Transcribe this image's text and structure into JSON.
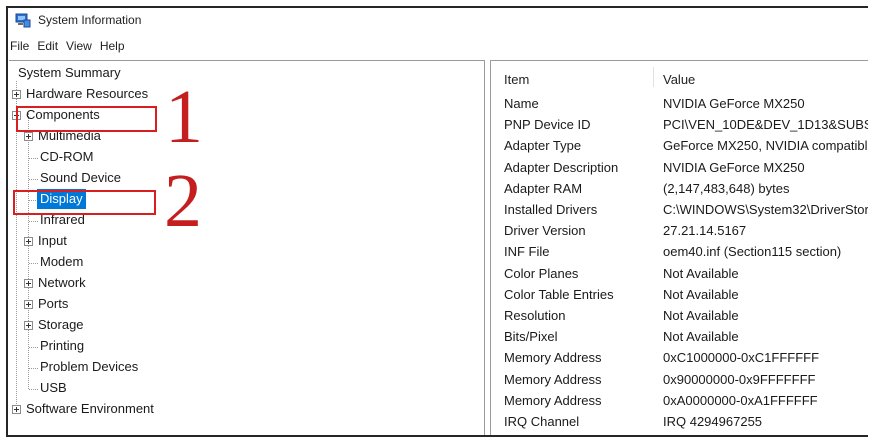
{
  "window": {
    "title": "System Information",
    "icon": "system-information-icon"
  },
  "menu": {
    "items": [
      "File",
      "Edit",
      "View",
      "Help"
    ]
  },
  "tree": {
    "root": "System Summary",
    "hardware_resources": "Hardware Resources",
    "components": "Components",
    "children": [
      {
        "label": "Multimedia",
        "expander": "plus"
      },
      {
        "label": "CD-ROM",
        "expander": ""
      },
      {
        "label": "Sound Device",
        "expander": ""
      },
      {
        "label": "Display",
        "expander": "",
        "selected": true
      },
      {
        "label": "Infrared",
        "expander": ""
      },
      {
        "label": "Input",
        "expander": "plus"
      },
      {
        "label": "Modem",
        "expander": ""
      },
      {
        "label": "Network",
        "expander": "plus"
      },
      {
        "label": "Ports",
        "expander": "plus"
      },
      {
        "label": "Storage",
        "expander": "plus"
      },
      {
        "label": "Printing",
        "expander": ""
      },
      {
        "label": "Problem Devices",
        "expander": ""
      },
      {
        "label": "USB",
        "expander": ""
      }
    ],
    "software_environment": "Software Environment"
  },
  "annotations": {
    "callout_1": "1",
    "callout_2": "2",
    "color": "#d81e1e"
  },
  "details": {
    "headers": {
      "item": "Item",
      "value": "Value"
    },
    "rows": [
      {
        "item": "Name",
        "value": "NVIDIA GeForce MX250"
      },
      {
        "item": "PNP Device ID",
        "value": "PCI\\VEN_10DE&DEV_1D13&SUBSY"
      },
      {
        "item": "Adapter Type",
        "value": "GeForce MX250, NVIDIA compatibl"
      },
      {
        "item": "Adapter Description",
        "value": "NVIDIA GeForce MX250"
      },
      {
        "item": "Adapter RAM",
        "value": "(2,147,483,648) bytes"
      },
      {
        "item": "Installed Drivers",
        "value": "C:\\WINDOWS\\System32\\DriverStor"
      },
      {
        "item": "Driver Version",
        "value": "27.21.14.5167"
      },
      {
        "item": "INF File",
        "value": "oem40.inf (Section115 section)"
      },
      {
        "item": "Color Planes",
        "value": "Not Available"
      },
      {
        "item": "Color Table Entries",
        "value": "Not Available"
      },
      {
        "item": "Resolution",
        "value": "Not Available"
      },
      {
        "item": "Bits/Pixel",
        "value": "Not Available"
      },
      {
        "item": "Memory Address",
        "value": "0xC1000000-0xC1FFFFFF"
      },
      {
        "item": "Memory Address",
        "value": "0x90000000-0x9FFFFFFF"
      },
      {
        "item": "Memory Address",
        "value": "0xA0000000-0xA1FFFFFF"
      },
      {
        "item": "IRQ Channel",
        "value": "IRQ 4294967255"
      }
    ]
  },
  "colors": {
    "selection": "#0078d7",
    "callout": "#d81e1e"
  }
}
